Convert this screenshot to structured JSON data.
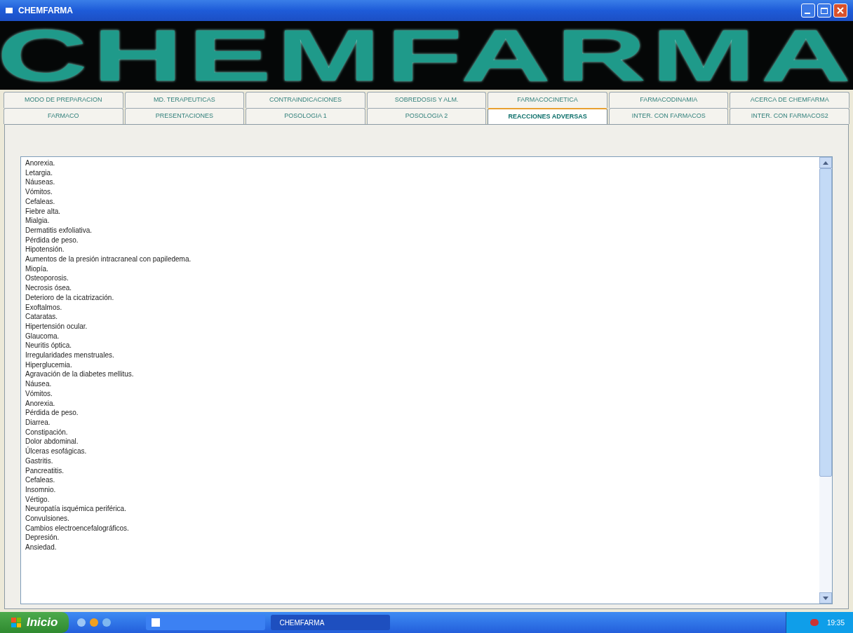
{
  "window": {
    "title": "CHEMFARMA"
  },
  "banner": {
    "logo": "CHEMFARMA"
  },
  "tab_rows": [
    {
      "tabs": [
        {
          "label": "MODO DE PREPARACION",
          "selected": false
        },
        {
          "label": "MD. TERAPEUTICAS",
          "selected": false
        },
        {
          "label": "CONTRAINDICACIONES",
          "selected": false
        },
        {
          "label": "SOBREDOSIS Y ALM.",
          "selected": false
        },
        {
          "label": "FARMACOCINETICA",
          "selected": false
        },
        {
          "label": "FARMACODINAMIA",
          "selected": false
        },
        {
          "label": "ACERCA DE CHEMFARMA",
          "selected": false
        }
      ]
    },
    {
      "tabs": [
        {
          "label": "FARMACO",
          "selected": false
        },
        {
          "label": "PRESENTACIONES",
          "selected": false
        },
        {
          "label": "POSOLOGIA 1",
          "selected": false
        },
        {
          "label": "POSOLOGIA 2",
          "selected": false
        },
        {
          "label": "REACCIONES ADVERSAS",
          "selected": true
        },
        {
          "label": "INTER. CON FARMACOS",
          "selected": false
        },
        {
          "label": "INTER. CON FARMACOS2",
          "selected": false
        }
      ]
    }
  ],
  "text_box": {
    "lines": [
      "Anorexia.",
      "Letargia.",
      "Náuseas.",
      "Vómitos.",
      "Cefaleas.",
      "Fiebre alta.",
      "Mialgia.",
      "Dermatitis exfoliativa.",
      "Pérdida de peso.",
      "Hipotensión.",
      "Aumentos de la presión intracraneal con papiledema.",
      "Miopía.",
      "Osteoporosis.",
      "Necrosis ósea.",
      "Deterioro de la cicatrización.",
      "Exoftalmos.",
      "Cataratas.",
      "Hipertensión ocular.",
      "Glaucoma.",
      "Neuritis óptica.",
      "Irregularidades menstruales.",
      "Hiperglucemia.",
      "Agravación de la diabetes mellitus.",
      "Náusea.",
      "Vómitos.",
      "Anorexia.",
      "Pérdida de peso.",
      "Diarrea.",
      "Constipación.",
      "Dolor abdominal.",
      "Úlceras esofágicas.",
      "Gastritis.",
      "Pancreatitis.",
      "Cefaleas.",
      "Insomnio.",
      "Vértigo.",
      "Neuropatía isquémica periférica.",
      "Convulsiones.",
      "Cambios electroencefalográficos.",
      "Depresión.",
      "Ansiedad."
    ]
  },
  "taskbar": {
    "start": "Inicio",
    "tasks": [
      {
        "label": "CHEMFARMA",
        "selected": true
      }
    ],
    "clock": "19:35"
  }
}
